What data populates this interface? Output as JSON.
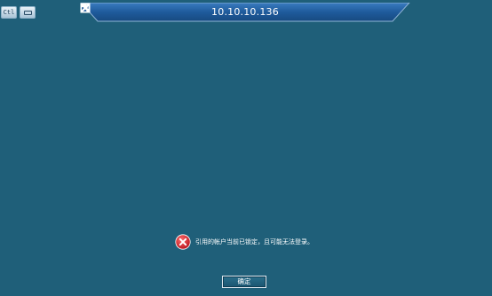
{
  "top_buttons": {
    "ctrl_alt_del_label": "Ctl",
    "keyboard_icon": "keyboard-icon"
  },
  "connection_bar": {
    "title": "10.10.10.136",
    "pin_icon": "pin-icon",
    "controls": [
      "minimize-icon",
      "restore-icon",
      "close-icon"
    ]
  },
  "dialog": {
    "message": "引用的帐户当前已锁定，且可能无法登录。",
    "icon": "error-icon",
    "ok_label": "确定"
  },
  "colors": {
    "desktop": "#1f5f79",
    "bar": "#1d5b97",
    "error": "#d8232a"
  }
}
